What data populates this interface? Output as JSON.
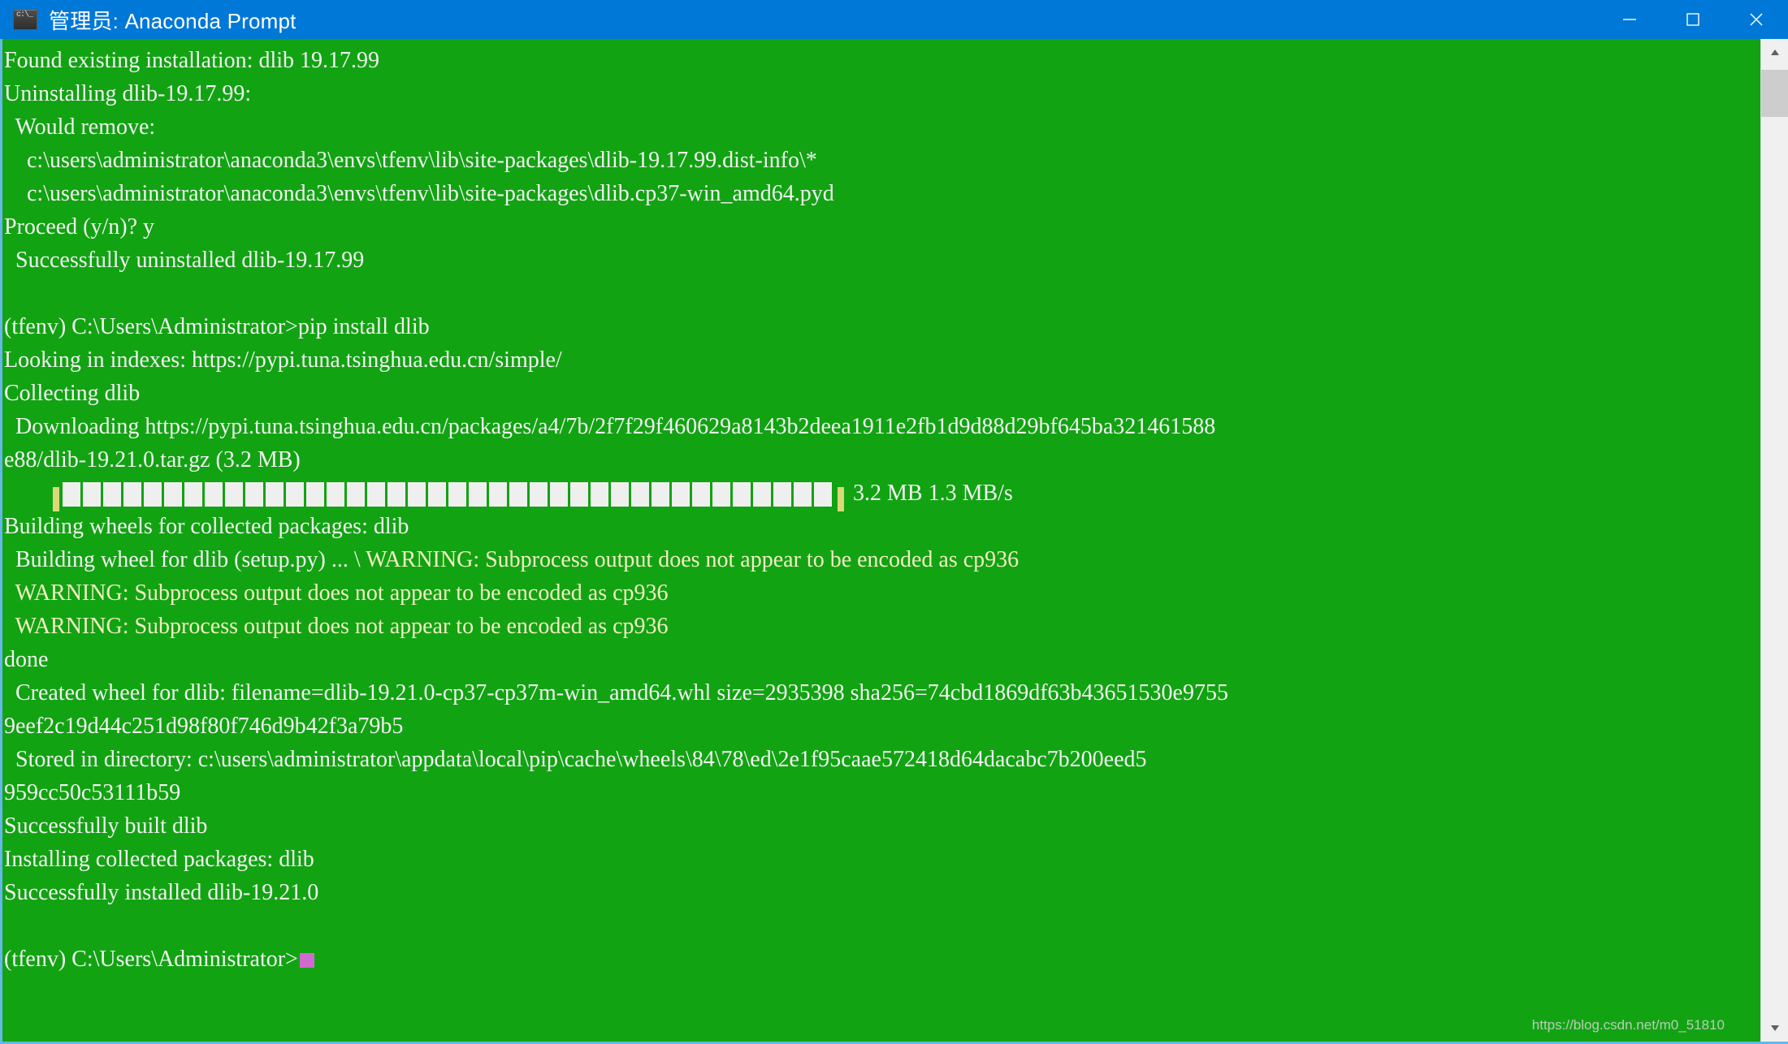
{
  "window": {
    "title": "管理员: Anaconda Prompt",
    "icon": "console-icon",
    "titlebar_color": "#0078d7",
    "minimize_label": "─",
    "maximize_label": "□",
    "close_label": "✕"
  },
  "terminal": {
    "background_color": "#12a312",
    "text_color": "#f2f2f2",
    "warning_color": "#f2eec4",
    "cursor_color": "#d06ad0",
    "lines": [
      {
        "text": "Found existing installation: dlib 19.17.99",
        "style": "normal"
      },
      {
        "text": "Uninstalling dlib-19.17.99:",
        "style": "normal"
      },
      {
        "text": "  Would remove:",
        "style": "normal"
      },
      {
        "text": "    c:\\users\\administrator\\anaconda3\\envs\\tfenv\\lib\\site-packages\\dlib-19.17.99.dist-info\\*",
        "style": "normal"
      },
      {
        "text": "    c:\\users\\administrator\\anaconda3\\envs\\tfenv\\lib\\site-packages\\dlib.cp37-win_amd64.pyd",
        "style": "normal"
      },
      {
        "text": "Proceed (y/n)? y",
        "style": "normal"
      },
      {
        "text": "  Successfully uninstalled dlib-19.17.99",
        "style": "normal"
      },
      {
        "text": "",
        "style": "normal"
      },
      {
        "text": "(tfenv) C:\\Users\\Administrator>pip install dlib",
        "style": "normal"
      },
      {
        "text": "Looking in indexes: https://pypi.tuna.tsinghua.edu.cn/simple/",
        "style": "normal"
      },
      {
        "text": "Collecting dlib",
        "style": "normal"
      },
      {
        "text": "  Downloading https://pypi.tuna.tsinghua.edu.cn/packages/a4/7b/2f7f29f460629a8143b2deea1911e2fb1d9d88d29bf645ba321461588",
        "style": "normal"
      },
      {
        "text": "e88/dlib-19.21.0.tar.gz (3.2 MB)",
        "style": "normal"
      },
      {
        "text": "",
        "style": "progress"
      },
      {
        "text": "Building wheels for collected packages: dlib",
        "style": "normal"
      },
      {
        "text": "  Building wheel for dlib (setup.py) ... \\ ",
        "style": "normal",
        "suffix": "WARNING: Subprocess output does not appear to be encoded as cp936",
        "suffix_style": "warn"
      },
      {
        "text": "  WARNING: Subprocess output does not appear to be encoded as cp936",
        "style": "warn"
      },
      {
        "text": "  WARNING: Subprocess output does not appear to be encoded as cp936",
        "style": "warn"
      },
      {
        "text": "done",
        "style": "normal"
      },
      {
        "text": "  Created wheel for dlib: filename=dlib-19.21.0-cp37-cp37m-win_amd64.whl size=2935398 sha256=74cbd1869df63b43651530e9755",
        "style": "normal"
      },
      {
        "text": "9eef2c19d44c251d98f80f746d9b42f3a79b5",
        "style": "normal"
      },
      {
        "text": "  Stored in directory: c:\\users\\administrator\\appdata\\local\\pip\\cache\\wheels\\84\\78\\ed\\2e1f95caae572418d64dacabc7b200eed5",
        "style": "normal"
      },
      {
        "text": "959cc50c53111b59",
        "style": "normal"
      },
      {
        "text": "Successfully built dlib",
        "style": "normal"
      },
      {
        "text": "Installing collected packages: dlib",
        "style": "normal"
      },
      {
        "text": "Successfully installed dlib-19.21.0",
        "style": "normal"
      },
      {
        "text": "",
        "style": "normal"
      },
      {
        "text": "(tfenv) C:\\Users\\Administrator>",
        "style": "prompt"
      }
    ],
    "progress": {
      "indent_chars": 8,
      "left_pipe": "|",
      "right_pipe": "|",
      "block_count": 38,
      "block_char": "█",
      "downloaded": "3.2 MB",
      "speed": "1.3 MB/s",
      "trailing_text": " 3.2 MB 1.3 MB/s"
    }
  },
  "scrollbar": {
    "up_arrow": "▲",
    "down_arrow": "▼",
    "position_percent": 3
  },
  "watermark": {
    "text": "https://blog.csdn.net/m0_51810"
  }
}
